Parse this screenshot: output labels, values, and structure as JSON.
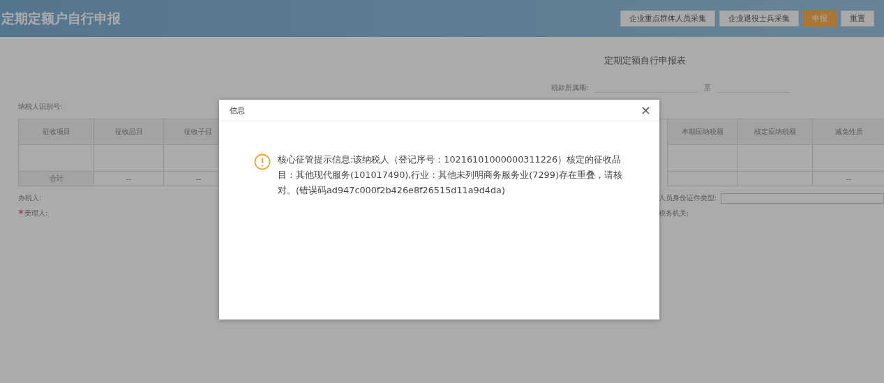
{
  "header": {
    "title": "定期定额户自行申报",
    "buttons": [
      "企业重点群体人员采集",
      "企业退役士兵采集",
      "申报",
      "重置"
    ]
  },
  "form": {
    "title": "定期定额自行申报表",
    "period_label": "税款所属期:",
    "period_to": "至",
    "taxpayer_id_label": "纳税人识别号:"
  },
  "table": {
    "columns": [
      "征收项目",
      "征收品目",
      "征收子目",
      "本期应纳税额",
      "核定应纳税额",
      "减免性质"
    ],
    "total_row": {
      "label": "合计",
      "cells": [
        "--",
        "--"
      ],
      "last_cell": "--"
    }
  },
  "footer_fields": {
    "left": [
      {
        "label": "办税人:"
      },
      {
        "label": "受理人:",
        "required_mark": "*"
      }
    ],
    "right": [
      "人员身份证件类型:",
      "税务机关:"
    ]
  },
  "dialog": {
    "title": "信息",
    "close": "×",
    "message": "核心征管提示信息:该纳税人（登记序号：10216101000000311226）核定的征收品目：其他现代服务(101017490),行业：其他未列明商务服务业(7299)存在重叠，请核对。(错误码ad947c000f2b426e8f26515d11a9d4da)"
  }
}
